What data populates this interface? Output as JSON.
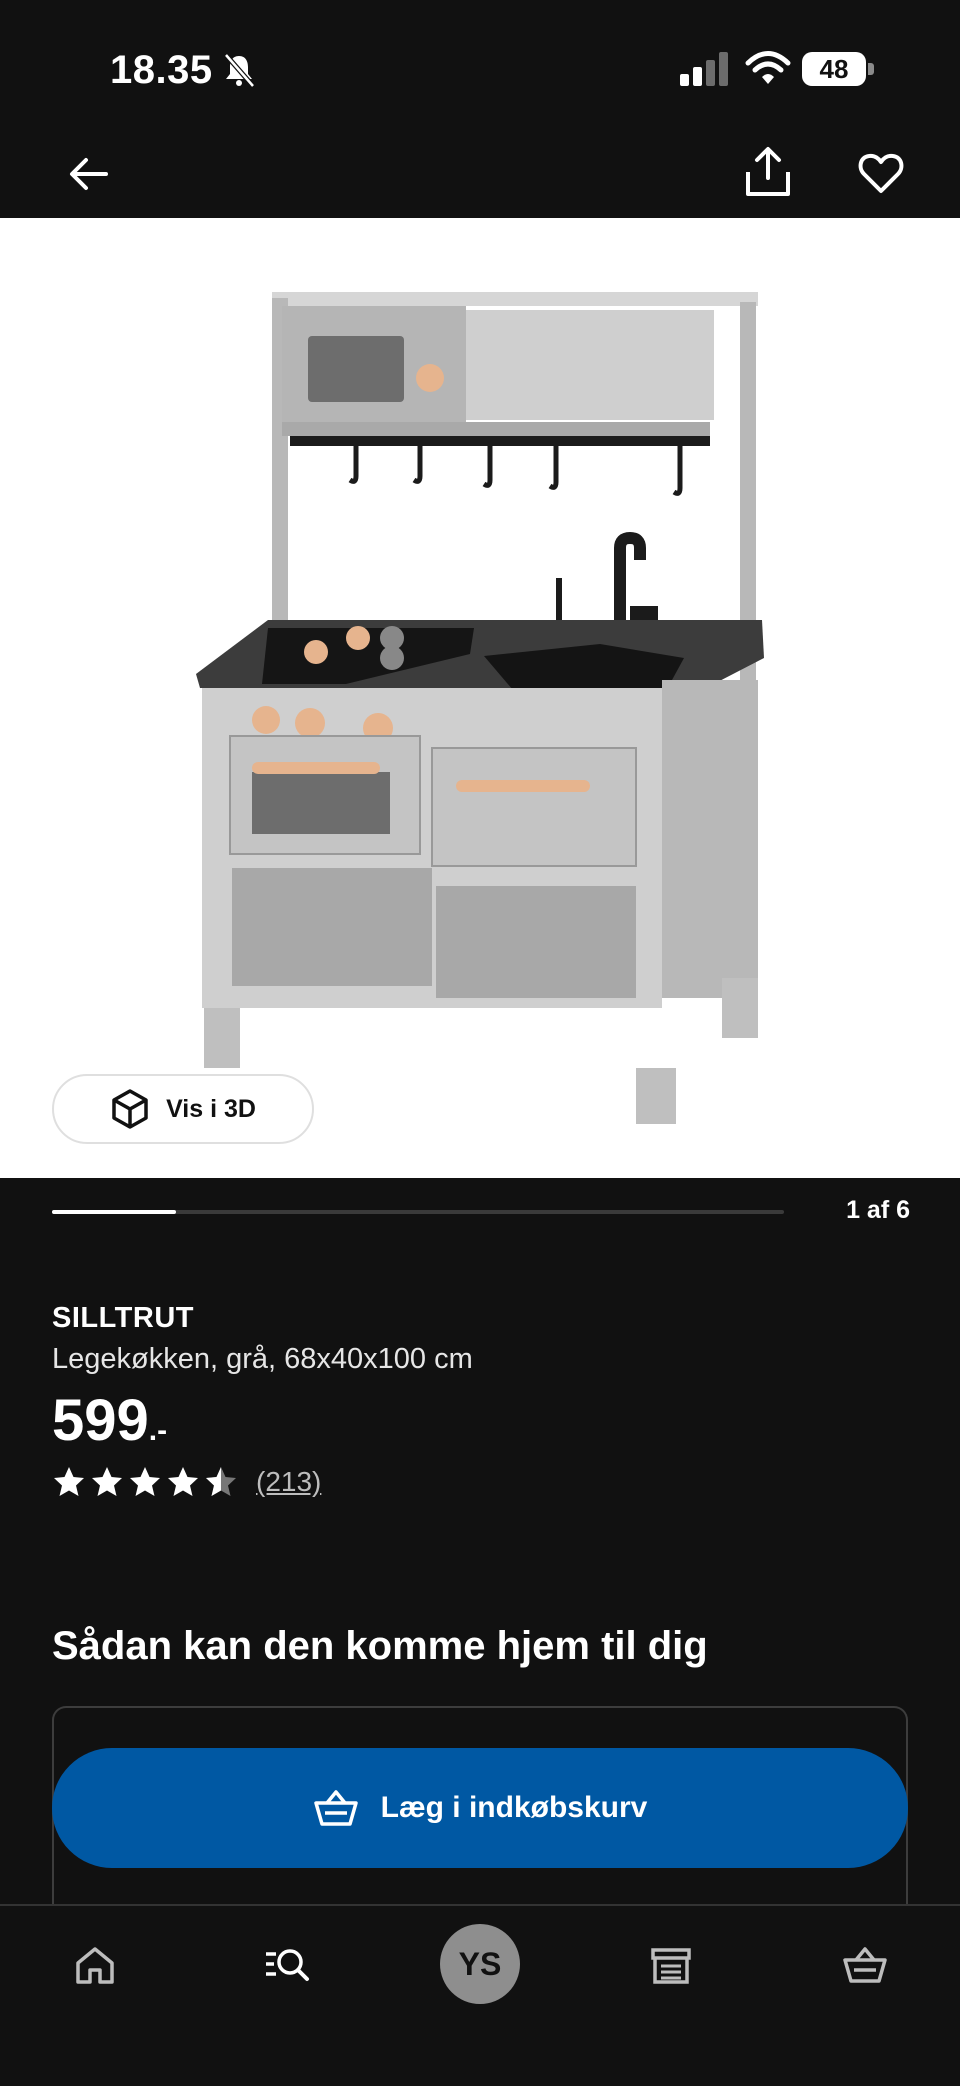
{
  "status_bar": {
    "time": "18.35",
    "battery": "48"
  },
  "gallery": {
    "view_3d_label": "Vis i 3D",
    "page_counter": "1 af 6",
    "progress_fraction": 0.17
  },
  "product": {
    "name": "SILLTRUT",
    "description": "Legekøkken, grå, 68x40x100 cm",
    "price": "599",
    "price_suffix": ".-",
    "rating": 4.5,
    "review_count": "(213)"
  },
  "delivery": {
    "heading": "Sådan kan den komme hjem til dig"
  },
  "cart": {
    "add_label": "Læg i indkøbskurv"
  },
  "tab_bar": {
    "avatar_initials": "YS"
  },
  "colors": {
    "background": "#111111",
    "accent_blue": "#0058a3",
    "avatar": "#8e8e8e"
  }
}
